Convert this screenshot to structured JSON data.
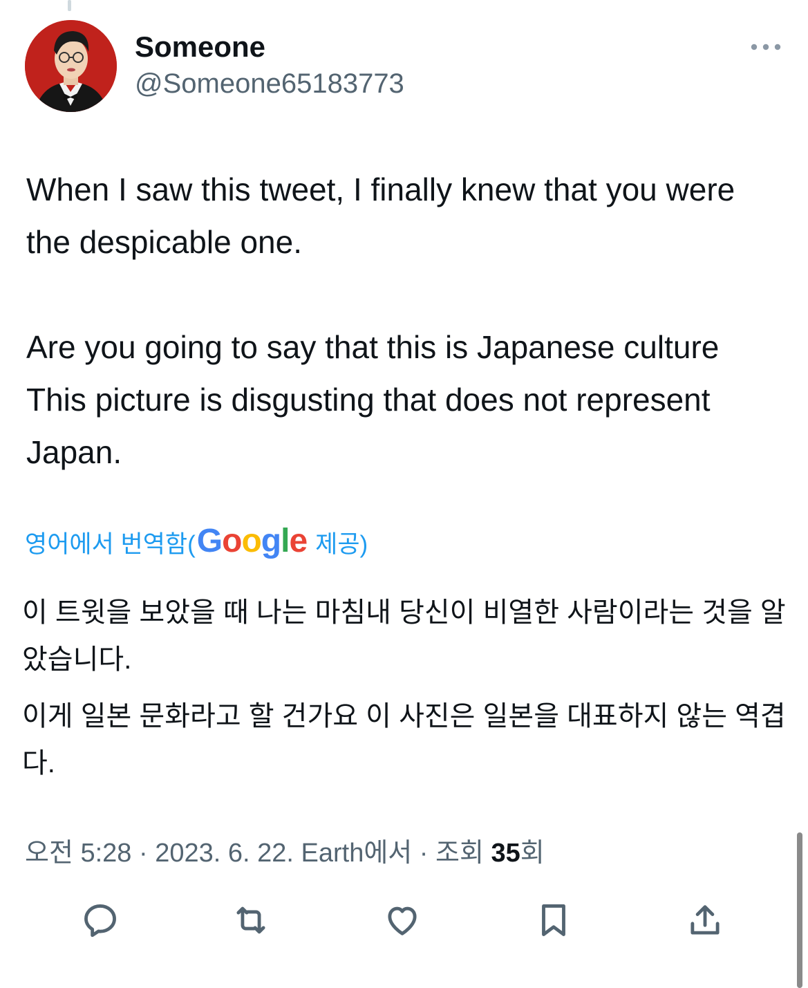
{
  "tweet": {
    "author": {
      "display_name": "Someone",
      "handle": "@Someone65183773"
    },
    "text_paragraphs": [
      "When I saw this tweet, I finally knew that you were the despicable one.",
      "Are you going to say that this is Japanese culture This picture is disgusting that does not represent Japan."
    ],
    "translation": {
      "label_prefix": "영어에서 번역함(",
      "provider_letters": [
        "G",
        "o",
        "o",
        "g",
        "l",
        "e"
      ],
      "label_suffix": " 제공)",
      "paragraphs": [
        "이 트윗을 보았을 때 나는 마침내 당신이 비열한 사람이라는 것을 알았습니다.",
        "이게 일본 문화라고 할 건가요 이 사진은 일본을 대표하지 않는 역겹다."
      ]
    },
    "meta": {
      "time": "오전 5:28",
      "separator": " · ",
      "date_source": "2023. 6. 22. Earth에서",
      "views_prefix": "조회 ",
      "views_count": "35",
      "views_suffix": "회"
    }
  },
  "actions": [
    {
      "name": "reply",
      "icon": "reply-icon"
    },
    {
      "name": "retweet",
      "icon": "retweet-icon"
    },
    {
      "name": "like",
      "icon": "heart-icon"
    },
    {
      "name": "bookmark",
      "icon": "bookmark-icon"
    },
    {
      "name": "share",
      "icon": "share-icon"
    }
  ],
  "colors": {
    "text": "#0f1419",
    "secondary": "#536471",
    "link": "#1d9bf0",
    "avatar_bg": "#c0221c"
  }
}
